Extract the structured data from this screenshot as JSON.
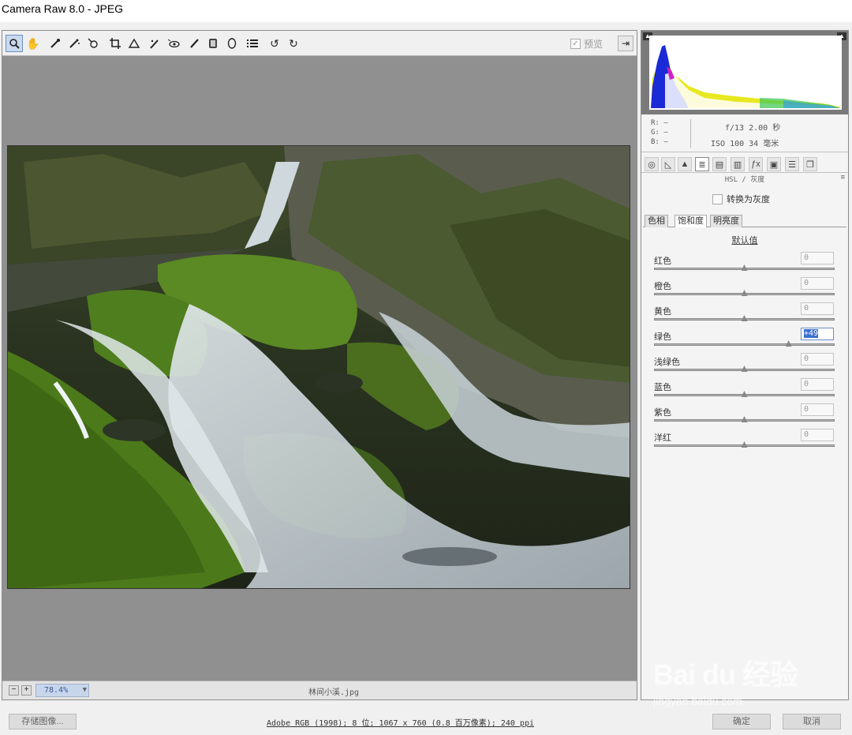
{
  "window": {
    "title": "Camera Raw 8.0 -  JPEG"
  },
  "toolbar": {
    "tools": [
      "zoom-icon",
      "hand-icon",
      "white-balance-icon",
      "color-sampler-icon",
      "target-adjust-icon",
      "crop-icon",
      "straighten-icon",
      "spot-removal-icon",
      "red-eye-icon",
      "adjustment-brush-icon",
      "graduated-filter-icon",
      "radial-filter-icon",
      "preferences-icon",
      "rotate-ccw-icon",
      "rotate-cw-icon"
    ],
    "preview_label": "预览",
    "preview_checked": true
  },
  "status": {
    "zoom": "78.4%",
    "filename": "林间小溪.jpg"
  },
  "info": {
    "r": "R:  —",
    "g": "G:  —",
    "b": "B:  —",
    "exif_line1": "f/13  2.00 秒",
    "exif_line2": "ISO 100  34 毫米"
  },
  "panel": {
    "title": "HSL / 灰度",
    "convert_gray": "转换为灰度",
    "subtabs": [
      "色相",
      "饱和度",
      "明亮度"
    ],
    "active_subtab": 1,
    "default_link": "默认值",
    "sliders": [
      {
        "label": "红色",
        "value": "0",
        "pos": 0.5
      },
      {
        "label": "橙色",
        "value": "0",
        "pos": 0.5
      },
      {
        "label": "黄色",
        "value": "0",
        "pos": 0.5
      },
      {
        "label": "绿色",
        "value": "+49",
        "pos": 0.745,
        "focused": true
      },
      {
        "label": "浅绿色",
        "value": "0",
        "pos": 0.5
      },
      {
        "label": "蓝色",
        "value": "0",
        "pos": 0.5
      },
      {
        "label": "紫色",
        "value": "0",
        "pos": 0.5
      },
      {
        "label": "洋红",
        "value": "0",
        "pos": 0.5
      }
    ]
  },
  "bottom": {
    "save_label": "存储图像...",
    "workflow": "Adobe RGB (1998); 8 位; 1067 x 760 (0.8 百万像素); 240 ppi",
    "ok_label": "确定",
    "cancel_label": "取消"
  },
  "watermark": {
    "text": "Bai du 经验",
    "sub": "jingyan.baidu.com"
  },
  "colors": {
    "accent": "#3a6fd0",
    "canvas": "#909090"
  }
}
